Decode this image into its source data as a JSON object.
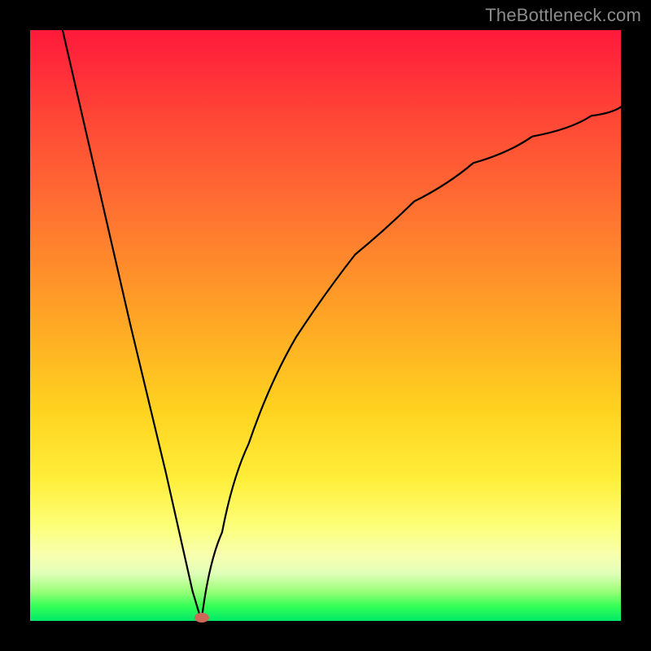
{
  "watermark": "TheBottleneck.com",
  "colors": {
    "frame": "#000000",
    "curve": "#000000",
    "marker_fill": "#cc6a5a",
    "marker_stroke": "#cc6a5a",
    "gradient": [
      "#ff1a3a",
      "#ff6a33",
      "#ffd21f",
      "#fcff7a",
      "#00e86a"
    ]
  },
  "chart_data": {
    "type": "line",
    "title": "",
    "xlabel": "",
    "ylabel": "",
    "x_range": [
      0,
      100
    ],
    "y_range": [
      0,
      100
    ],
    "notch": {
      "x": 29,
      "y": 0
    },
    "curve_left": [
      {
        "x": 5.5,
        "y": 100
      },
      {
        "x": 17.0,
        "y": 50.0
      },
      {
        "x": 23.0,
        "y": 25.0
      },
      {
        "x": 27.5,
        "y": 5.0
      },
      {
        "x": 29.0,
        "y": 0.0
      }
    ],
    "curve_right": [
      {
        "x": 29.0,
        "y": 0.0
      },
      {
        "x": 32.5,
        "y": 15.0
      },
      {
        "x": 37.0,
        "y": 30.0
      },
      {
        "x": 45.0,
        "y": 48.0
      },
      {
        "x": 55.0,
        "y": 62.0
      },
      {
        "x": 65.0,
        "y": 71.0
      },
      {
        "x": 75.0,
        "y": 77.5
      },
      {
        "x": 85.0,
        "y": 82.0
      },
      {
        "x": 95.0,
        "y": 85.5
      },
      {
        "x": 100.0,
        "y": 87.0
      }
    ],
    "marker": {
      "x": 29,
      "y": 0.5
    },
    "background_bands": [
      {
        "color": "red",
        "y_from": 60,
        "y_to": 100
      },
      {
        "color": "orange",
        "y_from": 35,
        "y_to": 60
      },
      {
        "color": "yellow",
        "y_from": 10,
        "y_to": 35
      },
      {
        "color": "green",
        "y_from": 0,
        "y_to": 10
      }
    ]
  }
}
